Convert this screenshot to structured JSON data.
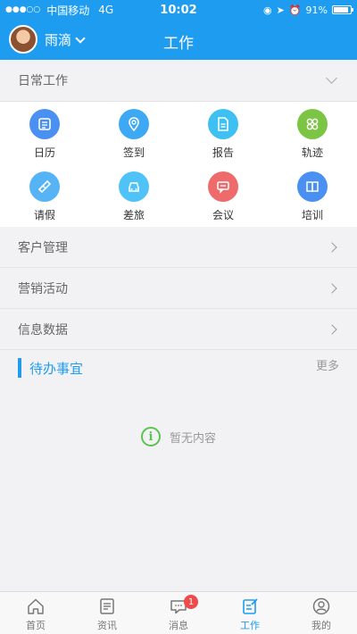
{
  "status_bar": {
    "carrier": "中国移动",
    "network": "4G",
    "time": "10:02",
    "battery": "91%"
  },
  "header": {
    "username": "雨滴",
    "title": "工作"
  },
  "daily_work": {
    "title": "日常工作",
    "items": [
      {
        "label": "日历",
        "icon": "calendar-icon",
        "color": "#4a8ff2"
      },
      {
        "label": "签到",
        "icon": "location-icon",
        "color": "#3da9f5"
      },
      {
        "label": "报告",
        "icon": "report-icon",
        "color": "#3fc0f2"
      },
      {
        "label": "轨迹",
        "icon": "track-icon",
        "color": "#7cc443"
      },
      {
        "label": "请假",
        "icon": "leave-icon",
        "color": "#56b3f5"
      },
      {
        "label": "差旅",
        "icon": "travel-icon",
        "color": "#4fc3f7"
      },
      {
        "label": "会议",
        "icon": "meeting-icon",
        "color": "#ef6b6b"
      },
      {
        "label": "培训",
        "icon": "training-icon",
        "color": "#4a8ff2"
      }
    ]
  },
  "menu": [
    {
      "label": "客户管理"
    },
    {
      "label": "营销活动"
    },
    {
      "label": "信息数据"
    }
  ],
  "todo": {
    "title": "待办事宜",
    "more": "更多",
    "empty_text": "暂无内容"
  },
  "tabbar": {
    "items": [
      {
        "label": "首页",
        "icon": "home-icon"
      },
      {
        "label": "资讯",
        "icon": "news-icon"
      },
      {
        "label": "消息",
        "icon": "message-icon",
        "badge": "1"
      },
      {
        "label": "工作",
        "icon": "work-icon",
        "active": true
      },
      {
        "label": "我的",
        "icon": "profile-icon"
      }
    ]
  },
  "colors": {
    "accent": "#1e9df0",
    "badge": "#f04b4b",
    "empty_icon": "#5bc451"
  }
}
